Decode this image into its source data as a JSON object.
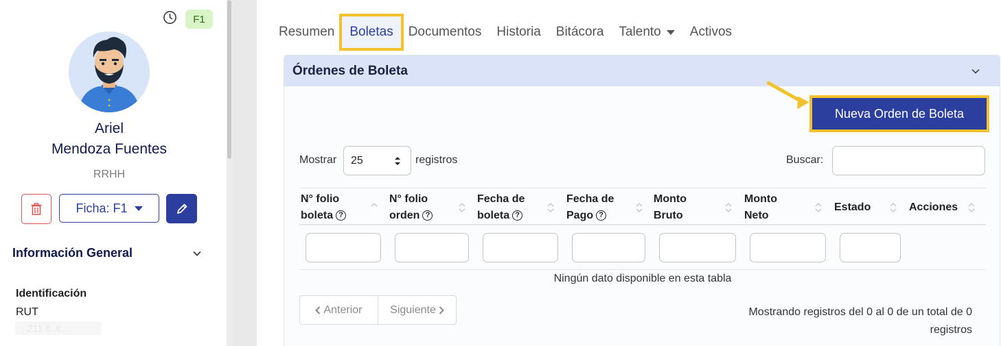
{
  "sidebar": {
    "badge": "F1",
    "first_name": "Ariel",
    "last_name": "Mendoza Fuentes",
    "department": "RRHH",
    "ficha_label": "Ficha: F1",
    "section_title": "Información General",
    "identification_label": "Identificación",
    "rut_label": "RUT",
    "rut_value": "..211.6..€.."
  },
  "tabs": [
    {
      "label": "Resumen"
    },
    {
      "label": "Boletas",
      "active": true
    },
    {
      "label": "Documentos"
    },
    {
      "label": "Historia"
    },
    {
      "label": "Bitácora"
    },
    {
      "label": "Talento",
      "dropdown": true
    },
    {
      "label": "Activos"
    }
  ],
  "card": {
    "title": "Órdenes de Boleta",
    "new_button": "Nueva Orden de Boleta"
  },
  "table_controls": {
    "show_label": "Mostrar",
    "page_size": "25",
    "records_label": "registros",
    "search_label": "Buscar:"
  },
  "columns": [
    {
      "line1": "N° folio",
      "line2": "boleta",
      "help": true
    },
    {
      "line1": "N° folio",
      "line2": "orden",
      "help": true
    },
    {
      "line1": "Fecha de",
      "line2": "boleta",
      "help": true
    },
    {
      "line1": "Fecha de",
      "line2": "Pago",
      "help": true
    },
    {
      "line1": "Monto",
      "line2": "Bruto",
      "help": false
    },
    {
      "line1": "Monto",
      "line2": "Neto",
      "help": false
    },
    {
      "line1": "Estado",
      "line2": "",
      "help": false
    },
    {
      "line1": "Acciones",
      "line2": "",
      "help": false
    }
  ],
  "empty_message": "Ningún dato disponible en esta tabla",
  "pagination": {
    "previous": "Anterior",
    "next": "Siguiente",
    "info_line1": "Mostrando registros del 0 al 0 de un total de 0",
    "info_line2": "registros"
  },
  "colors": {
    "primary": "#2d3f9e",
    "highlight": "#f2c12e",
    "header_bg": "#dae3f7",
    "badge_bg": "#d9f5c8",
    "danger": "#e25555"
  }
}
